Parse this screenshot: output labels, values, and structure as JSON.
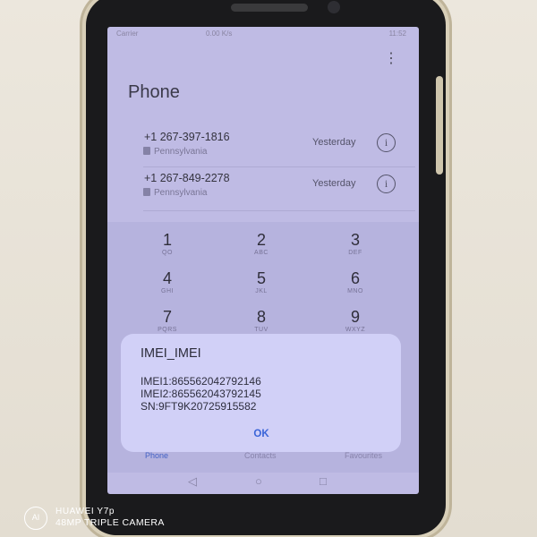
{
  "app": {
    "title": "Phone"
  },
  "status_bar": {
    "left": "Carrier",
    "mid": "0.00 K/s",
    "right": "11:52"
  },
  "icons": {
    "menu": "more-vertical-icon",
    "info": "info-circle-icon",
    "sim": "sim-card-icon"
  },
  "calls": [
    {
      "number": "+1 267-397-1816",
      "location": "Pennsylvania",
      "time": "Yesterday"
    },
    {
      "number": "+1 267-849-2278",
      "location": "Pennsylvania",
      "time": "Yesterday"
    }
  ],
  "dialpad": [
    {
      "digit": "1",
      "letters": "QO"
    },
    {
      "digit": "2",
      "letters": "ABC"
    },
    {
      "digit": "3",
      "letters": "DEF"
    },
    {
      "digit": "4",
      "letters": "GHI"
    },
    {
      "digit": "5",
      "letters": "JKL"
    },
    {
      "digit": "6",
      "letters": "MNO"
    },
    {
      "digit": "7",
      "letters": "PQRS"
    },
    {
      "digit": "8",
      "letters": "TUV"
    },
    {
      "digit": "9",
      "letters": "WXYZ"
    }
  ],
  "tabs": {
    "phone": "Phone",
    "contacts": "Contacts",
    "favourites": "Favourites"
  },
  "dialog": {
    "title": "IMEI_IMEI",
    "imei1": "IMEI1:865562042792146",
    "imei2": "IMEI2:865562043792145",
    "sn": "SN:9FT9K20725915582",
    "ok_label": "OK"
  },
  "watermark": {
    "logo": "AI",
    "line1": "HUAWEI Y7p",
    "line2": "48MP TRIPLE CAMERA"
  },
  "colors": {
    "screen_bg": "#c7c4ec",
    "dialog_bg": "#d1d0f7",
    "accent": "#3a64d8"
  }
}
